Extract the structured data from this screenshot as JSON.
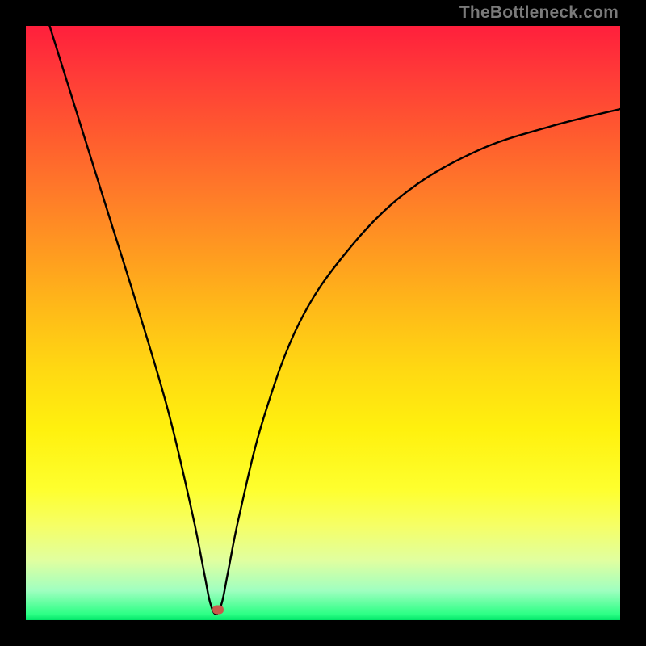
{
  "watermark": "TheBottleneck.com",
  "chart_data": {
    "type": "line",
    "title": "",
    "xlabel": "",
    "ylabel": "",
    "xlim": [
      0,
      100
    ],
    "ylim": [
      0,
      100
    ],
    "grid": false,
    "legend": false,
    "series": [
      {
        "name": "bottleneck-curve",
        "x": [
          4,
          9,
          14,
          19,
          24,
          28,
          30,
          31,
          32,
          33,
          34,
          36,
          40,
          46,
          54,
          64,
          76,
          88,
          100
        ],
        "y": [
          100,
          84,
          68,
          52,
          35,
          18,
          8,
          3,
          1,
          3,
          8,
          18,
          34,
          50,
          62,
          72,
          79,
          83,
          86
        ]
      }
    ],
    "marker": {
      "x": 32.3,
      "y": 1.7,
      "color": "#c85a4a"
    },
    "background": "red-yellow-green-vertical-gradient"
  }
}
